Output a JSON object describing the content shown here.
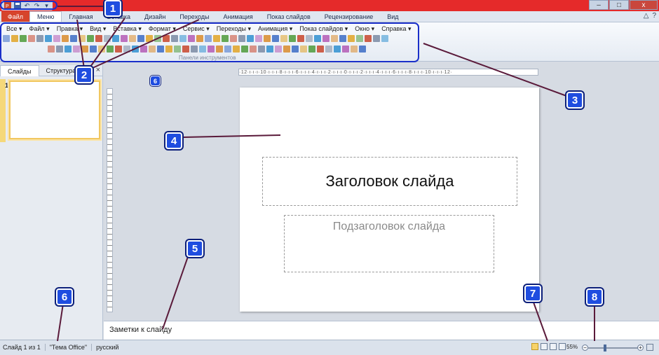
{
  "window": {
    "minimize_glyph": "–",
    "maximize_glyph": "□",
    "close_glyph": "x"
  },
  "qat": {
    "icons": [
      "powerpoint-logo-icon",
      "save-icon",
      "undo-icon",
      "redo-icon",
      "customize-icon"
    ]
  },
  "ribbon_tabs": {
    "file": "Файл",
    "items": [
      "Меню",
      "Главная",
      "Вставка",
      "Дизайн",
      "Переходы",
      "Анимация",
      "Показ слайдов",
      "Рецензирование",
      "Вид"
    ]
  },
  "menu_bar": {
    "items": [
      "Все ▾",
      "Файл ▾",
      "Правка ▾",
      "Вид ▾",
      "Вставка ▾",
      "Формат ▾",
      "Сервис ▾",
      "Переходы ▾",
      "Анимация ▾",
      "Показ слайдов ▾",
      "Окно ▾",
      "Справка ▾"
    ],
    "group_label": "Панели инструментов"
  },
  "left_pane": {
    "tab_slides": "Слайды",
    "tab_outline": "Структура",
    "close": "×",
    "slide_number": "1"
  },
  "ruler": {
    "text": "·12·ı·ı·ı·10·ı·ı·ı·8·ı·ı·ı·6·ı·ı·ı·4·ı·ı·ı·2·ı·ı·ı·0·ı·ı·ı·2·ı·ı·ı·4·ı·ı·ı·6·ı·ı·ı·8·ı·ı·ı·10·ı·ı·ı·12·"
  },
  "slide": {
    "title_placeholder": "Заголовок слайда",
    "subtitle_placeholder": "Подзаголовок слайда"
  },
  "notes": {
    "placeholder": "Заметки к слайду"
  },
  "status": {
    "slide_info": "Слайд 1 из 1",
    "theme": "\"Тема Office\"",
    "language": "русский",
    "zoom": "55%",
    "zoom_minus": "−",
    "zoom_plus": "+"
  },
  "markers": [
    "1",
    "2",
    "3",
    "4",
    "5",
    "6",
    "7",
    "8",
    "6"
  ],
  "colors": {
    "title_bar": "#e52a2a",
    "file_tab": "#d6442c",
    "marker": "#1f4de0",
    "callout_border": "#1a2fc9",
    "callout_line": "#5a1a3a"
  }
}
